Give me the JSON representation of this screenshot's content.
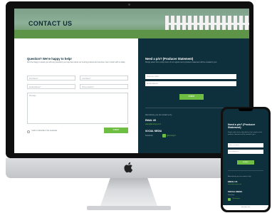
{
  "colors": {
    "brand_dark": "#0e2f3c",
    "accent_green": "#6fbe44",
    "heading_dark": "#0b2a36"
  },
  "hero": {
    "title": "CONTACT US"
  },
  "question_form": {
    "title": "Question? We're happy to help!",
    "description": "We'd be happy to assist you with any questions you may have about our fencing products and services. Get in touch with us today.",
    "fields": {
      "first_name": "First Name*",
      "last_name": "Last Name*",
      "email": "Email Address*",
      "phone": "Phone Number*",
      "message": "Message"
    },
    "checkbox_label": "I wish to subscribe to the newsletter",
    "submit_label": "SUBMIT"
  },
  "ps_form": {
    "title": "Need a p/s? (Producer Statement)",
    "description": "Simply select from a drop down of our register and a producer statement will be emailed to you.",
    "fields": {
      "select": "Select an option",
      "email": "Email Address*"
    },
    "submit_label": "SUBMIT",
    "alt_contact": "Alternatively, you can contact us by",
    "email_heading": "EMAIL US",
    "email_value": "sales@fencing.co.nz",
    "social_heading": "SOCIAL MEDIA",
    "social_label": "Facebook",
    "social_handle": "@fencingnz",
    "social_icon": "facebook-icon"
  },
  "mobile": {
    "title": "Need a p/s? (Producer Statement)",
    "description": "Simply select from a drop down of our register and a producer statement will be emailed to you.",
    "fields": {
      "select": "Select an option",
      "email": "Email Address*"
    },
    "submit_label": "SUBMIT",
    "alt_contact": "Alternatively, you can contact us by",
    "email_heading": "EMAIL US",
    "email_value": "sales@fencing.co.nz",
    "social_heading": "SOCIAL MEDIA",
    "social_label": "Facebook",
    "social_handle": "@fencingnz",
    "footer_text": "fencing.co.nz"
  }
}
